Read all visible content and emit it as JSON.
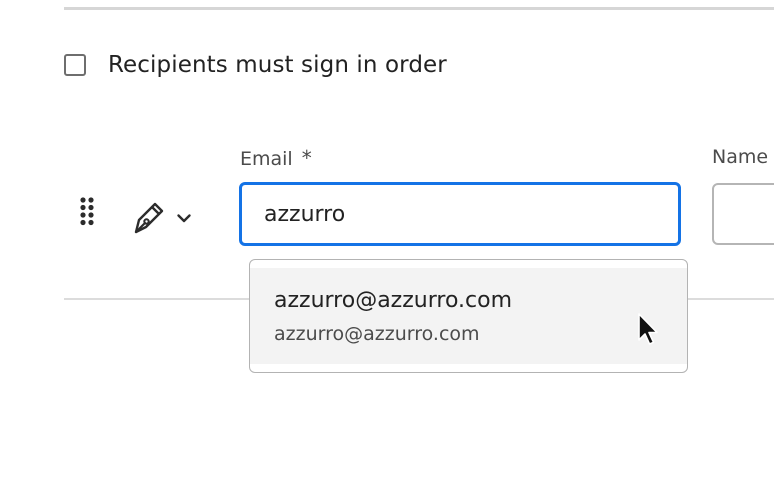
{
  "signing_order": {
    "checkbox_checked": false,
    "label": "Recipients must sign in order"
  },
  "recipient": {
    "email_label": "Email",
    "required_marker": "*",
    "name_label": "Name",
    "email_value": "azzurro",
    "name_value": "",
    "drag_icon": "drag-handle-icon",
    "role_icon": "pen-signer-icon",
    "role_dropdown_icon": "chevron-down-icon"
  },
  "autocomplete": {
    "items": [
      {
        "primary": "azzurro@azzurro.com",
        "secondary": "azzurro@azzurro.com"
      }
    ]
  },
  "colors": {
    "focus_border": "#1473e6",
    "hover_background": "#f3f3f3",
    "text": "#222222"
  }
}
